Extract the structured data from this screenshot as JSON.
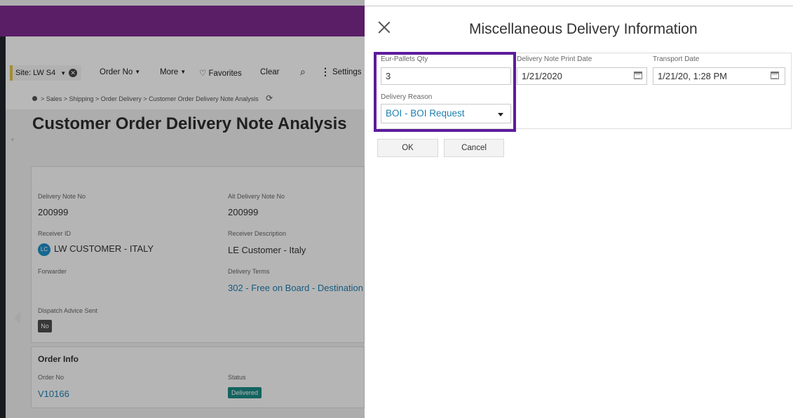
{
  "background": {
    "site_label": "Site: LW S4",
    "toolbar": {
      "order_no": "Order No",
      "more": "More",
      "favorites": "Favorites",
      "clear": "Clear",
      "settings": "Settings"
    },
    "breadcrumb": "> Sales > Shipping > Order Delivery > Customer Order Delivery Note Analysis",
    "page_title": "Customer Order Delivery Note Analysis",
    "fields": {
      "delivery_note_no_label": "Delivery Note No",
      "delivery_note_no_value": "200999",
      "alt_delivery_note_no_label": "Alt Delivery Note No",
      "alt_delivery_note_no_value": "200999",
      "receiver_id_label": "Receiver ID",
      "receiver_id_avatar": "LC",
      "receiver_id_value": "LW CUSTOMER - ITALY",
      "receiver_description_label": "Receiver Description",
      "receiver_description_value": "LE Customer - Italy",
      "forwarder_label": "Forwarder",
      "delivery_terms_label": "Delivery Terms",
      "delivery_terms_value": "302 - Free on Board - Destination",
      "dispatch_advice_label": "Dispatch Advice Sent",
      "dispatch_advice_value": "No"
    },
    "order_info": {
      "title": "Order Info",
      "order_no_label": "Order No",
      "order_no_value": "V10166",
      "status_label": "Status",
      "status_value": "Delivered"
    }
  },
  "dialog": {
    "title": "Miscellaneous Delivery Information",
    "eur_pallets_label": "Eur-Pallets Qty",
    "eur_pallets_value": "3",
    "print_date_label": "Delivery Note Print Date",
    "print_date_value": "1/21/2020",
    "transport_date_label": "Transport Date",
    "transport_date_value": "1/21/20, 1:28 PM",
    "delivery_reason_label": "Delivery Reason",
    "delivery_reason_value": "BOI - BOI Request",
    "ok_label": "OK",
    "cancel_label": "Cancel"
  },
  "colors": {
    "brand_header": "#7d2a8e",
    "highlight": "#5c1c9c",
    "link": "#1e7fb0",
    "status_delivered": "#1c8a84"
  },
  "icons": [
    "close-icon",
    "calendar-icon",
    "chevron-down-icon",
    "heart-icon",
    "search-icon",
    "kebab-icon",
    "refresh-icon",
    "home-icon"
  ]
}
